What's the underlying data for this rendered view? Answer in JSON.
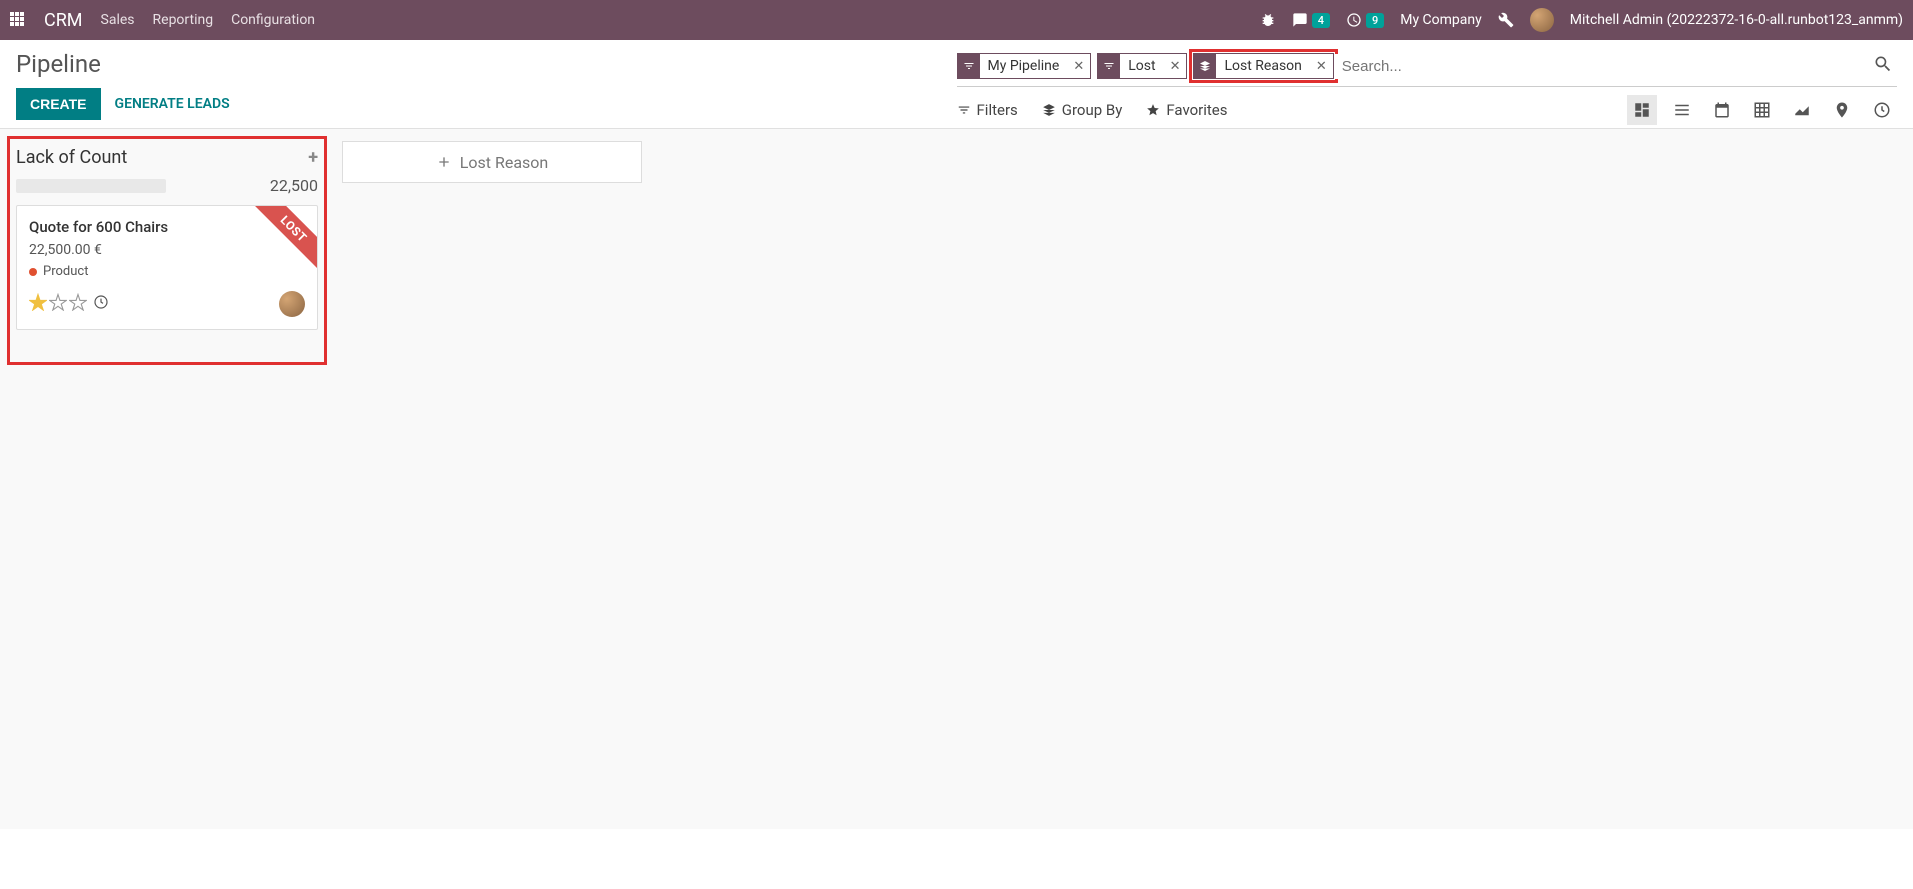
{
  "navbar": {
    "app_name": "CRM",
    "links": [
      "Sales",
      "Reporting",
      "Configuration"
    ],
    "chat_count": "4",
    "activity_count": "9",
    "company": "My Company",
    "user_name": "Mitchell Admin (20222372-16-0-all.runbot123_anmm)"
  },
  "control": {
    "title": "Pipeline",
    "create_btn": "CREATE",
    "generate_btn": "GENERATE LEADS"
  },
  "search": {
    "placeholder": "Search...",
    "facets": [
      {
        "type": "filter",
        "label": "My Pipeline"
      },
      {
        "type": "filter",
        "label": "Lost"
      },
      {
        "type": "groupby",
        "label": "Lost Reason"
      }
    ],
    "filters_label": "Filters",
    "groupby_label": "Group By",
    "favorites_label": "Favorites"
  },
  "kanban": {
    "column": {
      "title": "Lack of Count",
      "total": "22,500",
      "card": {
        "title": "Quote for 600 Chairs",
        "amount": "22,500.00 €",
        "tag": "Product",
        "ribbon": "LOST"
      }
    },
    "add_column_label": "Lost Reason"
  }
}
